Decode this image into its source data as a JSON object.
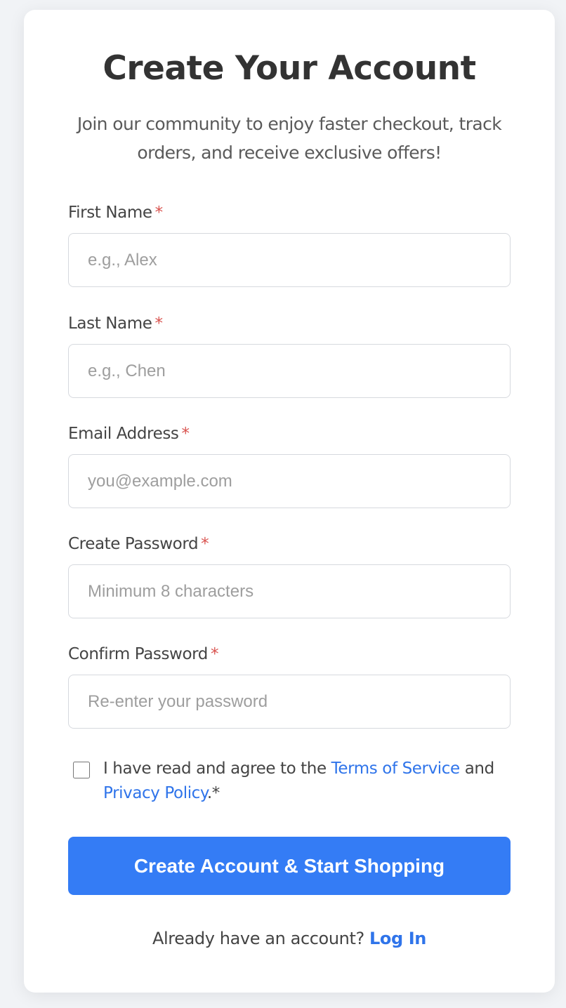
{
  "form": {
    "title": "Create Your Account",
    "subtitle": "Join our community to enjoy faster checkout, track orders, and receive exclusive offers!",
    "required_marker": "*",
    "fields": [
      {
        "label": "First Name",
        "placeholder": "e.g., Alex",
        "value": ""
      },
      {
        "label": "Last Name",
        "placeholder": "e.g., Chen",
        "value": ""
      },
      {
        "label": "Email Address",
        "placeholder": "you@example.com",
        "value": ""
      },
      {
        "label": "Create Password",
        "placeholder": "Minimum 8 characters",
        "value": ""
      },
      {
        "label": "Confirm Password",
        "placeholder": "Re-enter your password",
        "value": ""
      }
    ],
    "terms": {
      "checked": false,
      "prefix": "I have read and agree to the ",
      "terms_link": "Terms of Service",
      "middle": " and ",
      "privacy_link": "Privacy Policy",
      "suffix": ".*"
    },
    "submit_label": "Create Account & Start Shopping",
    "login_prompt": "Already have an account? ",
    "login_link": "Log In"
  },
  "colors": {
    "accent": "#347cf5",
    "link": "#2f74ea",
    "required": "#d9534f",
    "background": "#f1f3f6"
  }
}
